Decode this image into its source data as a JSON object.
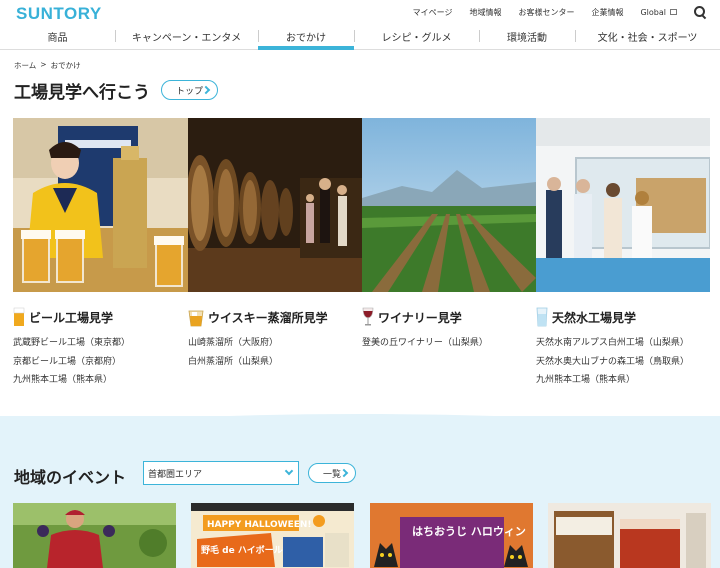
{
  "header": {
    "logo": "SUNTORY",
    "utility_links": [
      "マイページ",
      "地域情報",
      "お客様センター",
      "企業情報",
      "Global"
    ],
    "search_icon": "search-icon"
  },
  "nav": {
    "items": [
      "商品",
      "キャンペーン・エンタメ",
      "おでかけ",
      "レシピ・グルメ",
      "環境活動",
      "文化・社会・スポーツ"
    ],
    "active": "おでかけ",
    "accent_color": "#3cb4d9"
  },
  "breadcrumb": {
    "home": "ホーム",
    "separator": ">",
    "current": "おでかけ"
  },
  "page": {
    "title": "工場見学へ行こう",
    "top_button": "トップ"
  },
  "tours": [
    {
      "title": "ビール工場見学",
      "icon": "beer-glass-icon",
      "links": [
        "武蔵野ビール工場（東京都）",
        "京都ビール工場（京都府）",
        "九州熊本工場（熊本県）"
      ]
    },
    {
      "title": "ウイスキー蒸溜所見学",
      "icon": "whisky-glass-icon",
      "links": [
        "山崎蒸溜所（大阪府）",
        "白州蒸溜所（山梨県）"
      ]
    },
    {
      "title": "ワイナリー見学",
      "icon": "wine-glass-icon",
      "links": [
        "登美の丘ワイナリー（山梨県）"
      ]
    },
    {
      "title": "天然水工場見学",
      "icon": "water-glass-icon",
      "links": [
        "天然水南アルプス白州工場（山梨県）",
        "天然水奥大山ブナの森工場（鳥取県）",
        "九州熊本工場（熊本県）"
      ]
    }
  ],
  "events": {
    "title": "地域のイベント",
    "region_select": "首都圏エリア",
    "list_button": "一覧",
    "banner_texts": {
      "halloween": "HAPPY HALLOWEEN!",
      "highball": "野毛 de ハイボール祭り",
      "hachioji": "はちおうじ ハロウィン"
    }
  },
  "colors": {
    "brand": "#38b1d8",
    "band": "#e3f3fa"
  }
}
